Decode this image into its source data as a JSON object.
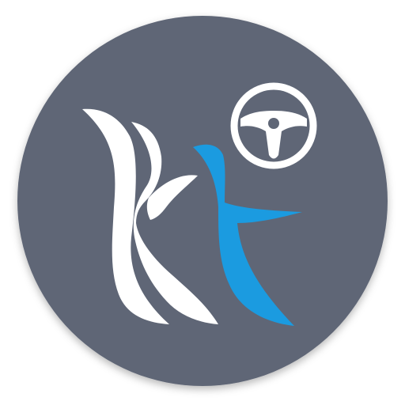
{
  "icon": {
    "name": "kt-driver-app-icon",
    "logo_text": "Kt",
    "glyphs": [
      "steering-wheel-icon"
    ],
    "colors": {
      "background_circle": "#5F6676",
      "letter_k": "#FFFFFF",
      "letter_t": "#1B9BE0",
      "steering_wheel": "#FFFFFF"
    }
  }
}
